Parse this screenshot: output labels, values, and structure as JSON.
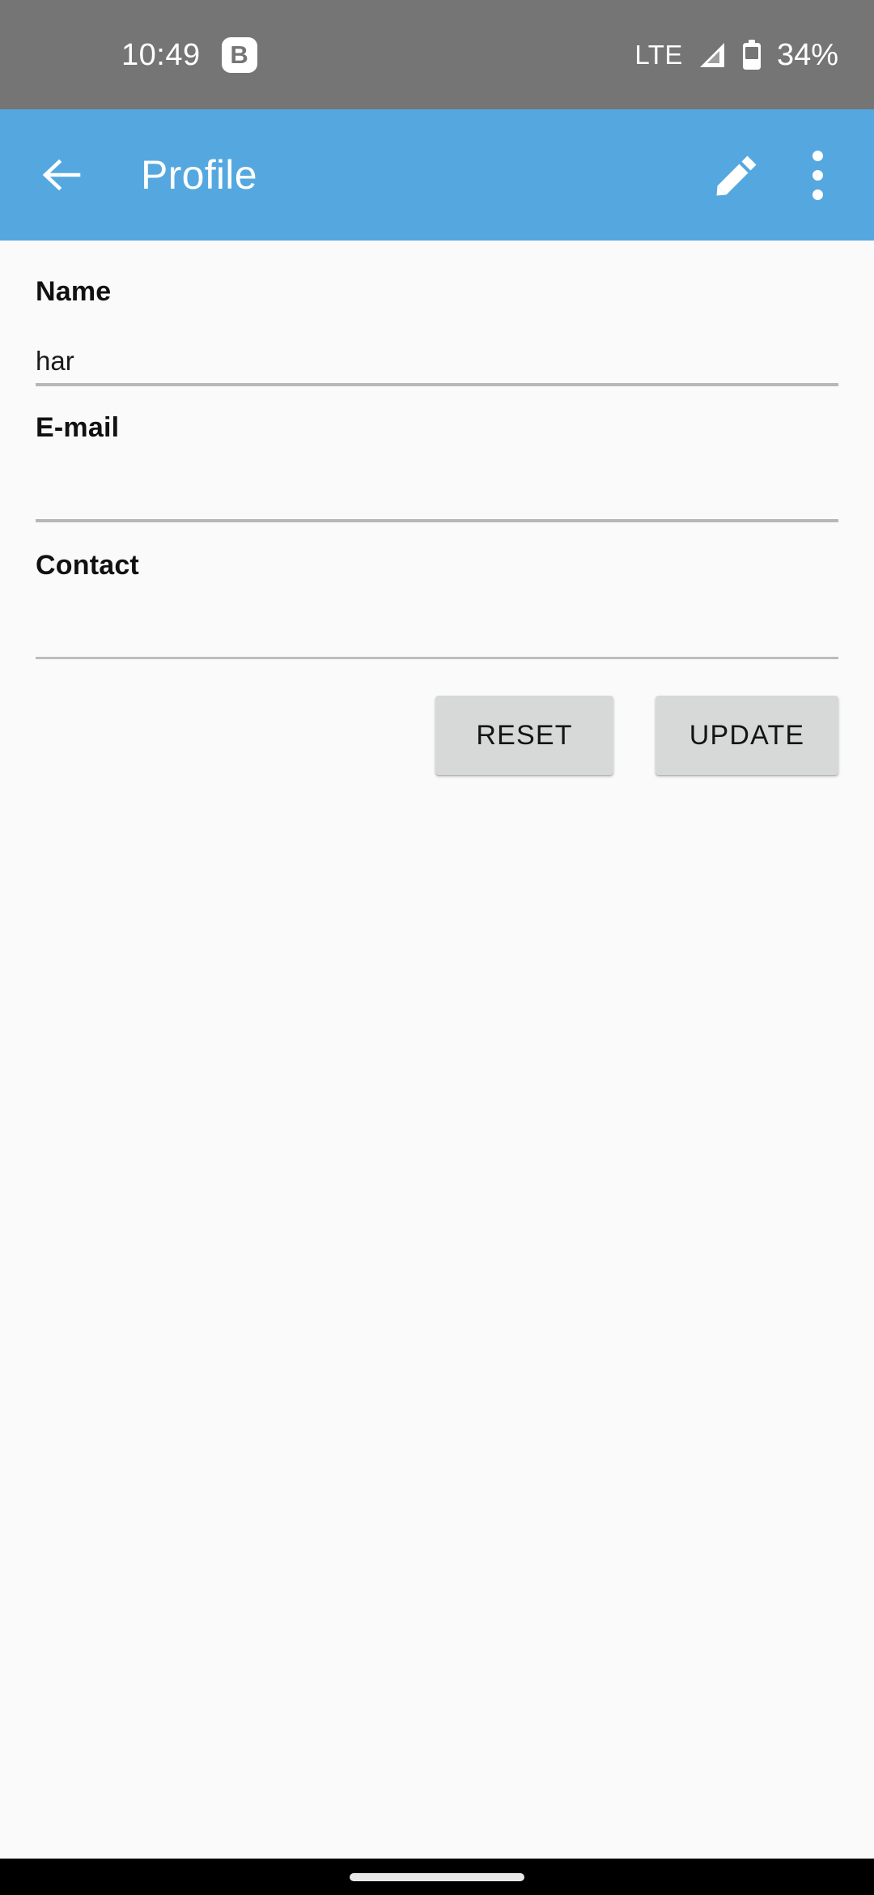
{
  "status_bar": {
    "time": "10:49",
    "app_badge_letter": "B",
    "network_type": "LTE",
    "battery_percent": "34%",
    "background_color": "#757575",
    "icons": [
      "signal-icon",
      "battery-icon"
    ]
  },
  "app_bar": {
    "title": "Profile",
    "background_color": "#55a8df",
    "back_icon": "back-arrow-icon",
    "edit_icon": "pencil-icon",
    "overflow_icon": "more-vertical-icon"
  },
  "form": {
    "fields": [
      {
        "label": "Name",
        "value": "har",
        "placeholder": ""
      },
      {
        "label": "E-mail",
        "value": "",
        "placeholder": ""
      },
      {
        "label": "Contact",
        "value": "",
        "placeholder": ""
      }
    ]
  },
  "buttons": {
    "reset_label": "RESET",
    "update_label": "UPDATE",
    "background_color": "#d7d8d8"
  },
  "page": {
    "background_color": "#fafafa",
    "nav_bar_color": "#000000"
  }
}
